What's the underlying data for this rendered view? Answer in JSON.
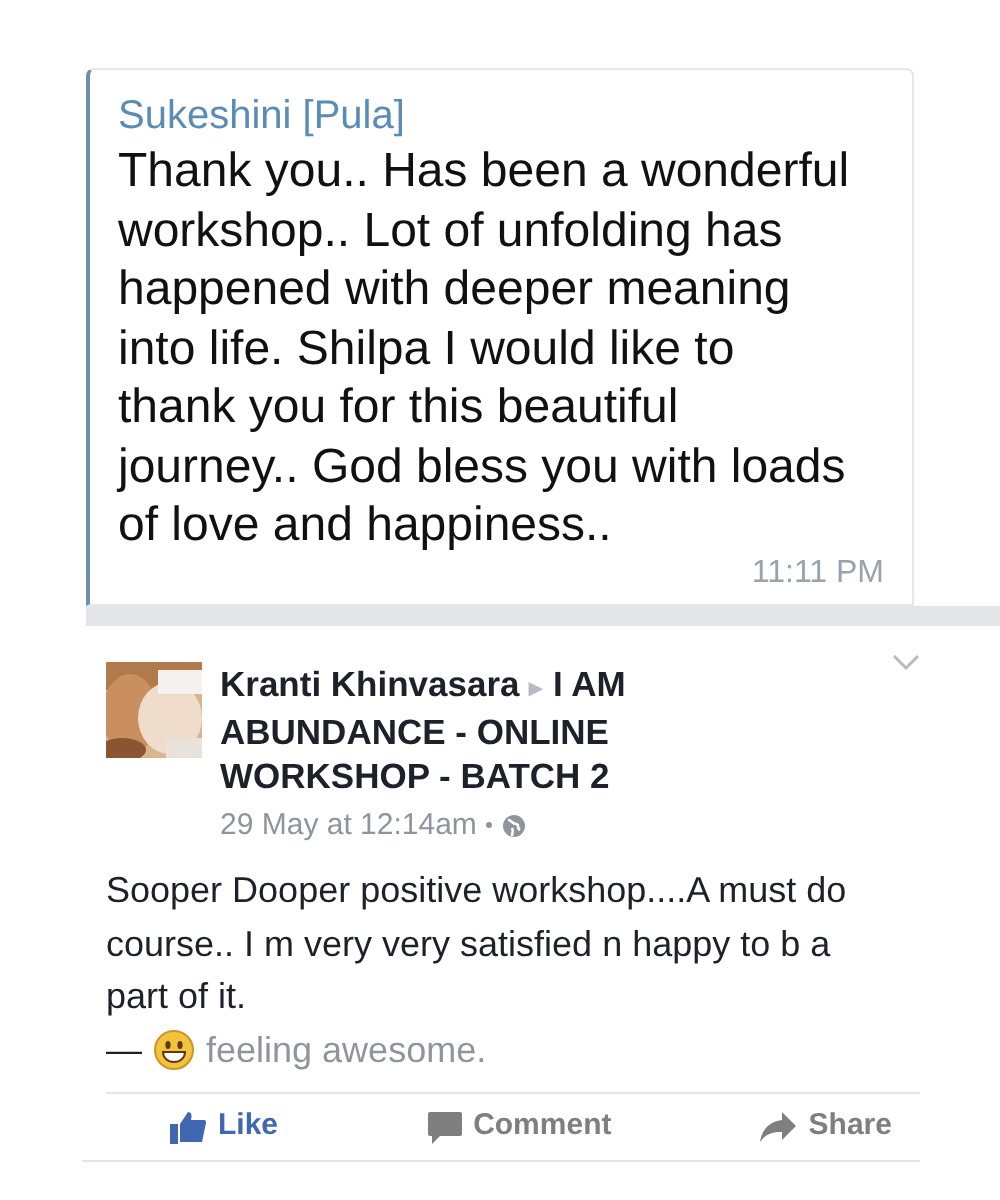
{
  "message": {
    "sender": "Sukeshini [Pula]",
    "text": "Thank you.. Has been a wonderful workshop.. Lot of unfolding has happened with deeper meaning into life. Shilpa I would like to thank you for this beautiful journey.. God bless you with loads of love and happiness..",
    "time": "11:11 PM"
  },
  "post": {
    "author": "Kranti Khinvasara",
    "arrow": "▸",
    "group": "I AM ABUNDANCE - ONLINE WORKSHOP - BATCH 2",
    "date": "29 May at 12:14am",
    "text": "Sooper Dooper positive workshop....A must do course.. I m very very satisfied n happy to b a part of it.",
    "feeling": {
      "separator": "—",
      "text": "feeling awesome."
    },
    "actions": [
      {
        "kind": "like",
        "label": "Like",
        "selected": true
      },
      {
        "kind": "comment",
        "label": "Comment",
        "selected": false
      },
      {
        "kind": "share",
        "label": "Share",
        "selected": false
      }
    ]
  }
}
